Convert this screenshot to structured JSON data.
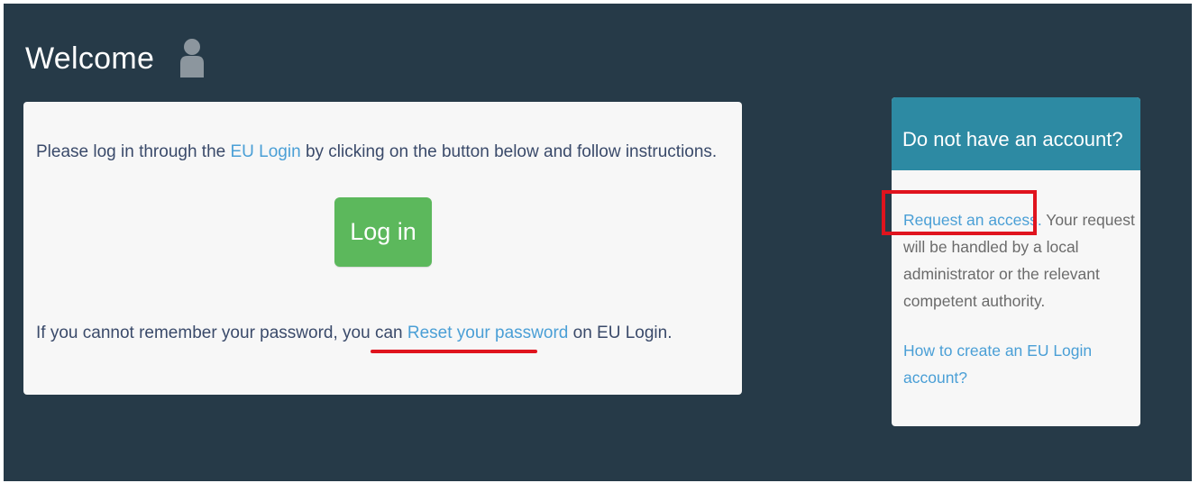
{
  "header": {
    "title": "Welcome",
    "icon": "user-icon"
  },
  "login_panel": {
    "intro_prefix": "Please log in through the ",
    "intro_link": "EU Login",
    "intro_suffix": " by clicking on the button below and follow instructions.",
    "login_button_label": "Log in",
    "reset_prefix": "If you cannot remember your password, you can ",
    "reset_link": "Reset your password",
    "reset_suffix": " on EU Login."
  },
  "account_panel": {
    "header_title": "Do not have an account?",
    "request_link": "Request an access.",
    "request_text": " Your request will be handled by a local administrator or the relevant competent authority.",
    "howto_link": "How to create an EU Login account?"
  },
  "colors": {
    "background": "#263a48",
    "panel": "#f7f7f7",
    "link": "#4a9fd6",
    "login_button": "#5cb85c",
    "account_header": "#2d8aa3",
    "annotation": "#e0141e"
  }
}
